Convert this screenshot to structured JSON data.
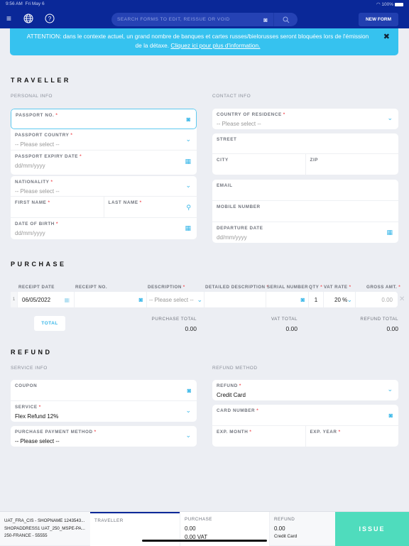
{
  "status_bar": {
    "time": "9:56 AM",
    "date": "Fri May 6",
    "battery": "100%"
  },
  "header": {
    "search_placeholder": "SEARCH FORMS TO EDIT, REISSUE OR VOID",
    "new_form_label": "NEW FORM"
  },
  "alert": {
    "text": "ATTENTION: dans le contexte actuel, un grand nombre de banques et cartes russes/bielorusses seront bloquées lors de l'émission de la détaxe.",
    "link": "Cliquez ici pour plus d'information."
  },
  "traveller": {
    "title": "TRAVELLER",
    "personal_info": "PERSONAL INFO",
    "contact_info": "CONTACT INFO",
    "passport_no": "PASSPORT NO.",
    "passport_country": "PASSPORT COUNTRY",
    "passport_country_value": "-- Please select --",
    "passport_expiry": "PASSPORT EXPIRY DATE",
    "passport_expiry_value": "dd/mm/yyyy",
    "nationality": "NATIONALITY",
    "nationality_value": "-- Please select --",
    "first_name": "FIRST NAME",
    "last_name": "LAST NAME",
    "dob": "DATE OF BIRTH",
    "dob_value": "dd/mm/yyyy",
    "country_residence": "COUNTRY OF RESIDENCE",
    "country_residence_value": "-- Please select --",
    "street": "STREET",
    "city": "CITY",
    "zip": "ZIP",
    "email": "EMAIL",
    "mobile": "MOBILE NUMBER",
    "departure": "DEPARTURE DATE",
    "departure_value": "dd/mm/yyyy"
  },
  "purchase": {
    "title": "PURCHASE",
    "columns": [
      "RECEIPT DATE",
      "RECEIPT NO.",
      "DESCRIPTION",
      "DETAILED DESCRIPTION",
      "SERIAL NUMBER",
      "QTY",
      "VAT RATE",
      "GROSS AMT."
    ],
    "row": {
      "index": "1",
      "receipt_date": "06/05/2022",
      "receipt_no": "",
      "description": "-- Please select --",
      "detailed_description": "",
      "serial_number": "",
      "qty": "1",
      "vat_rate": "20 %",
      "gross_amt": "0.00"
    },
    "total_button": "TOTAL",
    "purchase_total_label": "PURCHASE TOTAL",
    "purchase_total": "0.00",
    "vat_total_label": "VAT TOTAL",
    "vat_total": "0.00",
    "refund_total_label": "REFUND TOTAL",
    "refund_total": "0.00"
  },
  "refund": {
    "title": "REFUND",
    "service_info": "SERVICE INFO",
    "refund_method": "REFUND METHOD",
    "coupon": "COUPON",
    "service": "SERVICE",
    "service_value": "Flex Refund 12%",
    "payment_method": "PURCHASE PAYMENT METHOD",
    "payment_method_value": "-- Please select --",
    "refund": "REFUND",
    "refund_value": "Credit Card",
    "card_number": "CARD NUMBER",
    "exp_month": "EXP. MONTH",
    "exp_year": "EXP. YEAR"
  },
  "bottom": {
    "shop_line1": "UAT_FRA_CIS - SHOPNAME 1243543...",
    "shop_line2": "SHOPADDRESS1 UAT_250_MSPE-PA...",
    "shop_line3": "250-FRANCE - 55555",
    "traveller_label": "TRAVELLER",
    "purchase_label": "PURCHASE",
    "purchase_value": "0.00",
    "purchase_vat": "0.00 VAT",
    "refund_label": "REFUND",
    "refund_value": "0.00",
    "refund_method": "Credit Card",
    "issue_label": "ISSUE"
  },
  "colors": {
    "header": "#0a2898",
    "alert": "#36c2ef",
    "accent": "#36b6e8",
    "issue": "#4fdcbd",
    "required": "#f2545b"
  }
}
